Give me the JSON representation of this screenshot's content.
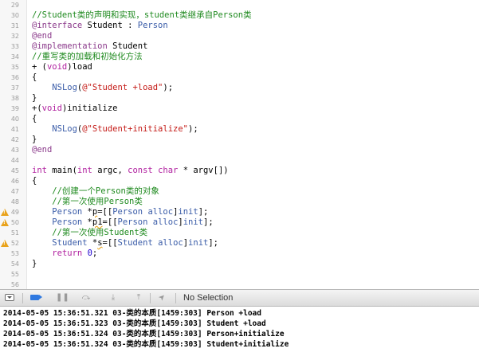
{
  "editor": {
    "lines": [
      {
        "num": "29",
        "warning": false,
        "tokens": []
      },
      {
        "num": "30",
        "warning": false,
        "tokens": [
          {
            "c": "comment",
            "t": "//Student类的声明和实现，student类继承自Person类"
          }
        ]
      },
      {
        "num": "31",
        "warning": false,
        "tokens": [
          {
            "c": "directive",
            "t": "@interface"
          },
          {
            "c": "plain",
            "t": " Student : "
          },
          {
            "c": "type",
            "t": "Person"
          }
        ]
      },
      {
        "num": "32",
        "warning": false,
        "tokens": [
          {
            "c": "directive",
            "t": "@end"
          }
        ]
      },
      {
        "num": "33",
        "warning": false,
        "tokens": [
          {
            "c": "directive",
            "t": "@implementation"
          },
          {
            "c": "plain",
            "t": " Student"
          }
        ]
      },
      {
        "num": "34",
        "warning": false,
        "tokens": [
          {
            "c": "comment",
            "t": "//重写类的加载和初始化方法"
          }
        ]
      },
      {
        "num": "35",
        "warning": false,
        "tokens": [
          {
            "c": "plain",
            "t": "+ ("
          },
          {
            "c": "keyword",
            "t": "void"
          },
          {
            "c": "plain",
            "t": ")load"
          }
        ]
      },
      {
        "num": "36",
        "warning": false,
        "tokens": [
          {
            "c": "plain",
            "t": "{"
          }
        ]
      },
      {
        "num": "37",
        "warning": false,
        "tokens": [
          {
            "c": "plain",
            "t": "    "
          },
          {
            "c": "type",
            "t": "NSLog"
          },
          {
            "c": "plain",
            "t": "("
          },
          {
            "c": "string",
            "t": "@\"Student +load\""
          },
          {
            "c": "plain",
            "t": ");"
          }
        ]
      },
      {
        "num": "38",
        "warning": false,
        "tokens": [
          {
            "c": "plain",
            "t": "}"
          }
        ]
      },
      {
        "num": "39",
        "warning": false,
        "tokens": [
          {
            "c": "plain",
            "t": "+("
          },
          {
            "c": "keyword",
            "t": "void"
          },
          {
            "c": "plain",
            "t": ")initialize"
          }
        ]
      },
      {
        "num": "40",
        "warning": false,
        "tokens": [
          {
            "c": "plain",
            "t": "{"
          }
        ]
      },
      {
        "num": "41",
        "warning": false,
        "tokens": [
          {
            "c": "plain",
            "t": "    "
          },
          {
            "c": "type",
            "t": "NSLog"
          },
          {
            "c": "plain",
            "t": "("
          },
          {
            "c": "string",
            "t": "@\"Student+initialize\""
          },
          {
            "c": "plain",
            "t": ");"
          }
        ]
      },
      {
        "num": "42",
        "warning": false,
        "tokens": [
          {
            "c": "plain",
            "t": "}"
          }
        ]
      },
      {
        "num": "43",
        "warning": false,
        "tokens": [
          {
            "c": "directive",
            "t": "@end"
          }
        ]
      },
      {
        "num": "44",
        "warning": false,
        "tokens": []
      },
      {
        "num": "45",
        "warning": false,
        "tokens": [
          {
            "c": "keyword",
            "t": "int"
          },
          {
            "c": "plain",
            "t": " main("
          },
          {
            "c": "keyword",
            "t": "int"
          },
          {
            "c": "plain",
            "t": " argc, "
          },
          {
            "c": "keyword",
            "t": "const"
          },
          {
            "c": "plain",
            "t": " "
          },
          {
            "c": "keyword",
            "t": "char"
          },
          {
            "c": "plain",
            "t": " * argv[])"
          }
        ]
      },
      {
        "num": "46",
        "warning": false,
        "tokens": [
          {
            "c": "plain",
            "t": "{"
          }
        ]
      },
      {
        "num": "47",
        "warning": false,
        "tokens": [
          {
            "c": "comment",
            "t": "    //创建一个Person类的对象"
          }
        ]
      },
      {
        "num": "48",
        "warning": false,
        "tokens": [
          {
            "c": "comment",
            "t": "    //第一次使用Person类"
          }
        ]
      },
      {
        "num": "49",
        "warning": true,
        "tokens": [
          {
            "c": "plain",
            "t": "    "
          },
          {
            "c": "type",
            "t": "Person"
          },
          {
            "c": "plain",
            "t": " *"
          },
          {
            "c": "uline",
            "t": "p"
          },
          {
            "c": "plain",
            "t": "=[["
          },
          {
            "c": "type",
            "t": "Person"
          },
          {
            "c": "plain",
            "t": " "
          },
          {
            "c": "type",
            "t": "alloc"
          },
          {
            "c": "plain",
            "t": "]"
          },
          {
            "c": "type",
            "t": "init"
          },
          {
            "c": "plain",
            "t": "];"
          }
        ]
      },
      {
        "num": "50",
        "warning": true,
        "tokens": [
          {
            "c": "plain",
            "t": "    "
          },
          {
            "c": "type",
            "t": "Person"
          },
          {
            "c": "plain",
            "t": " *"
          },
          {
            "c": "uline",
            "t": "p1"
          },
          {
            "c": "plain",
            "t": "=[["
          },
          {
            "c": "type",
            "t": "Person"
          },
          {
            "c": "plain",
            "t": " "
          },
          {
            "c": "type",
            "t": "alloc"
          },
          {
            "c": "plain",
            "t": "]"
          },
          {
            "c": "type",
            "t": "init"
          },
          {
            "c": "plain",
            "t": "];"
          }
        ]
      },
      {
        "num": "51",
        "warning": false,
        "tokens": [
          {
            "c": "comment",
            "t": "    //第一次使用Student类"
          }
        ]
      },
      {
        "num": "52",
        "warning": true,
        "tokens": [
          {
            "c": "plain",
            "t": "    "
          },
          {
            "c": "type",
            "t": "Student"
          },
          {
            "c": "plain",
            "t": " *"
          },
          {
            "c": "uline",
            "t": "s"
          },
          {
            "c": "plain",
            "t": "=[["
          },
          {
            "c": "type",
            "t": "Student"
          },
          {
            "c": "plain",
            "t": " "
          },
          {
            "c": "type",
            "t": "alloc"
          },
          {
            "c": "plain",
            "t": "]"
          },
          {
            "c": "type",
            "t": "init"
          },
          {
            "c": "plain",
            "t": "];"
          }
        ]
      },
      {
        "num": "53",
        "warning": false,
        "tokens": [
          {
            "c": "plain",
            "t": "    "
          },
          {
            "c": "keyword",
            "t": "return"
          },
          {
            "c": "plain",
            "t": " "
          },
          {
            "c": "number",
            "t": "0"
          },
          {
            "c": "plain",
            "t": ";"
          }
        ]
      },
      {
        "num": "54",
        "warning": false,
        "tokens": [
          {
            "c": "plain",
            "t": "}"
          }
        ]
      },
      {
        "num": "55",
        "warning": false,
        "tokens": []
      },
      {
        "num": "56",
        "warning": false,
        "tokens": []
      }
    ],
    "colors": {
      "comment": "#1f8a1f",
      "directive": "#8b3a8b",
      "keyword": "#b01f9f",
      "type": "#3a5ca8",
      "string": "#c41a16",
      "warning": "#e9a31c"
    }
  },
  "debug_bar": {
    "buttons": [
      {
        "icon": "hide-debug-area-icon"
      },
      {
        "icon": "breakpoints-toggle-icon"
      },
      {
        "icon": "pause-icon",
        "glyph": "❚❚"
      },
      {
        "icon": "step-over-icon",
        "glyph": "⤼"
      },
      {
        "icon": "step-into-icon",
        "glyph": "⤓"
      },
      {
        "icon": "step-out-icon",
        "glyph": "⤒"
      },
      {
        "icon": "simulate-location-icon",
        "glyph": "➤"
      }
    ],
    "selection": "No Selection"
  },
  "console": {
    "lines": [
      "2014-05-05 15:36:51.321 03-类的本质[1459:303] Person +load",
      "2014-05-05 15:36:51.323 03-类的本质[1459:303] Student +load",
      "2014-05-05 15:36:51.324 03-类的本质[1459:303] Person+initialize",
      "2014-05-05 15:36:51.324 03-类的本质[1459:303] Student+initialize"
    ]
  }
}
